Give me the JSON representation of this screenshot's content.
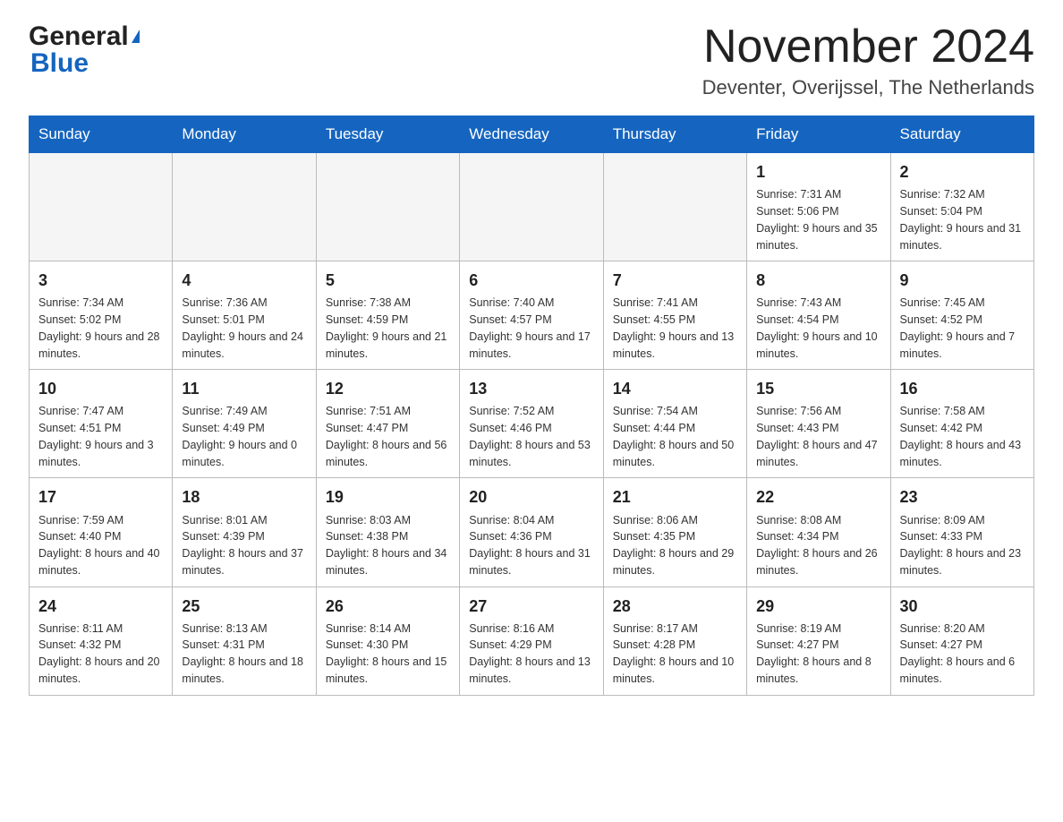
{
  "header": {
    "logo_text1": "General",
    "logo_text2": "Blue",
    "title": "November 2024",
    "subtitle": "Deventer, Overijssel, The Netherlands"
  },
  "days_of_week": [
    "Sunday",
    "Monday",
    "Tuesday",
    "Wednesday",
    "Thursday",
    "Friday",
    "Saturday"
  ],
  "weeks": [
    [
      {
        "day": "",
        "info": ""
      },
      {
        "day": "",
        "info": ""
      },
      {
        "day": "",
        "info": ""
      },
      {
        "day": "",
        "info": ""
      },
      {
        "day": "",
        "info": ""
      },
      {
        "day": "1",
        "info": "Sunrise: 7:31 AM\nSunset: 5:06 PM\nDaylight: 9 hours\nand 35 minutes."
      },
      {
        "day": "2",
        "info": "Sunrise: 7:32 AM\nSunset: 5:04 PM\nDaylight: 9 hours\nand 31 minutes."
      }
    ],
    [
      {
        "day": "3",
        "info": "Sunrise: 7:34 AM\nSunset: 5:02 PM\nDaylight: 9 hours\nand 28 minutes."
      },
      {
        "day": "4",
        "info": "Sunrise: 7:36 AM\nSunset: 5:01 PM\nDaylight: 9 hours\nand 24 minutes."
      },
      {
        "day": "5",
        "info": "Sunrise: 7:38 AM\nSunset: 4:59 PM\nDaylight: 9 hours\nand 21 minutes."
      },
      {
        "day": "6",
        "info": "Sunrise: 7:40 AM\nSunset: 4:57 PM\nDaylight: 9 hours\nand 17 minutes."
      },
      {
        "day": "7",
        "info": "Sunrise: 7:41 AM\nSunset: 4:55 PM\nDaylight: 9 hours\nand 13 minutes."
      },
      {
        "day": "8",
        "info": "Sunrise: 7:43 AM\nSunset: 4:54 PM\nDaylight: 9 hours\nand 10 minutes."
      },
      {
        "day": "9",
        "info": "Sunrise: 7:45 AM\nSunset: 4:52 PM\nDaylight: 9 hours\nand 7 minutes."
      }
    ],
    [
      {
        "day": "10",
        "info": "Sunrise: 7:47 AM\nSunset: 4:51 PM\nDaylight: 9 hours\nand 3 minutes."
      },
      {
        "day": "11",
        "info": "Sunrise: 7:49 AM\nSunset: 4:49 PM\nDaylight: 9 hours\nand 0 minutes."
      },
      {
        "day": "12",
        "info": "Sunrise: 7:51 AM\nSunset: 4:47 PM\nDaylight: 8 hours\nand 56 minutes."
      },
      {
        "day": "13",
        "info": "Sunrise: 7:52 AM\nSunset: 4:46 PM\nDaylight: 8 hours\nand 53 minutes."
      },
      {
        "day": "14",
        "info": "Sunrise: 7:54 AM\nSunset: 4:44 PM\nDaylight: 8 hours\nand 50 minutes."
      },
      {
        "day": "15",
        "info": "Sunrise: 7:56 AM\nSunset: 4:43 PM\nDaylight: 8 hours\nand 47 minutes."
      },
      {
        "day": "16",
        "info": "Sunrise: 7:58 AM\nSunset: 4:42 PM\nDaylight: 8 hours\nand 43 minutes."
      }
    ],
    [
      {
        "day": "17",
        "info": "Sunrise: 7:59 AM\nSunset: 4:40 PM\nDaylight: 8 hours\nand 40 minutes."
      },
      {
        "day": "18",
        "info": "Sunrise: 8:01 AM\nSunset: 4:39 PM\nDaylight: 8 hours\nand 37 minutes."
      },
      {
        "day": "19",
        "info": "Sunrise: 8:03 AM\nSunset: 4:38 PM\nDaylight: 8 hours\nand 34 minutes."
      },
      {
        "day": "20",
        "info": "Sunrise: 8:04 AM\nSunset: 4:36 PM\nDaylight: 8 hours\nand 31 minutes."
      },
      {
        "day": "21",
        "info": "Sunrise: 8:06 AM\nSunset: 4:35 PM\nDaylight: 8 hours\nand 29 minutes."
      },
      {
        "day": "22",
        "info": "Sunrise: 8:08 AM\nSunset: 4:34 PM\nDaylight: 8 hours\nand 26 minutes."
      },
      {
        "day": "23",
        "info": "Sunrise: 8:09 AM\nSunset: 4:33 PM\nDaylight: 8 hours\nand 23 minutes."
      }
    ],
    [
      {
        "day": "24",
        "info": "Sunrise: 8:11 AM\nSunset: 4:32 PM\nDaylight: 8 hours\nand 20 minutes."
      },
      {
        "day": "25",
        "info": "Sunrise: 8:13 AM\nSunset: 4:31 PM\nDaylight: 8 hours\nand 18 minutes."
      },
      {
        "day": "26",
        "info": "Sunrise: 8:14 AM\nSunset: 4:30 PM\nDaylight: 8 hours\nand 15 minutes."
      },
      {
        "day": "27",
        "info": "Sunrise: 8:16 AM\nSunset: 4:29 PM\nDaylight: 8 hours\nand 13 minutes."
      },
      {
        "day": "28",
        "info": "Sunrise: 8:17 AM\nSunset: 4:28 PM\nDaylight: 8 hours\nand 10 minutes."
      },
      {
        "day": "29",
        "info": "Sunrise: 8:19 AM\nSunset: 4:27 PM\nDaylight: 8 hours\nand 8 minutes."
      },
      {
        "day": "30",
        "info": "Sunrise: 8:20 AM\nSunset: 4:27 PM\nDaylight: 8 hours\nand 6 minutes."
      }
    ]
  ]
}
